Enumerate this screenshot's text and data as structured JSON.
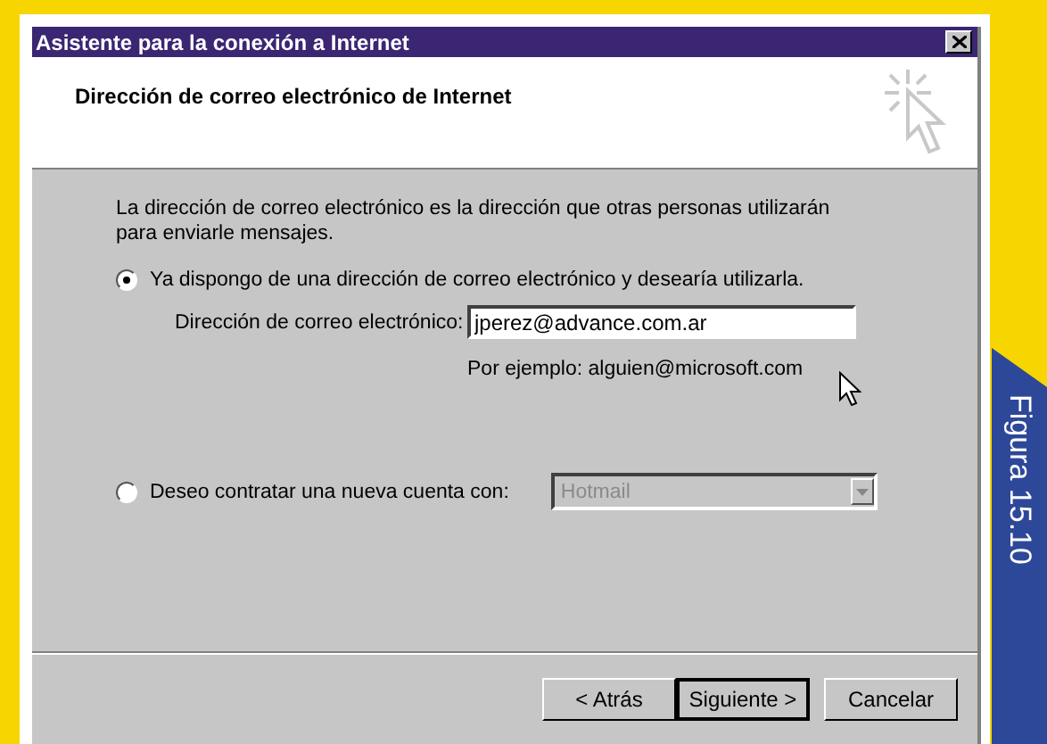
{
  "window": {
    "title": "Asistente para la conexión a Internet"
  },
  "header": {
    "title": "Dirección de correo electrónico de Internet"
  },
  "intro": "La dirección de correo electrónico es la dirección que otras personas utilizarán para enviarle mensajes.",
  "options": [
    {
      "label": "Ya dispongo de una dirección de correo electrónico y desearía utilizarla.",
      "selected": true
    },
    {
      "label": "Deseo contratar una nueva cuenta con:",
      "selected": false
    }
  ],
  "email_field": {
    "label": "Dirección de correo electrónico:",
    "value": "jperez@advance.com.ar"
  },
  "example": "Por ejemplo: alguien@microsoft.com",
  "provider_combo": {
    "value": "Hotmail",
    "disabled": true
  },
  "buttons": [
    {
      "label": "< Atrás",
      "default": false
    },
    {
      "label": "Siguiente >",
      "default": true
    },
    {
      "label": "Cancelar",
      "default": false
    }
  ],
  "figure_label": "Figura 15.10"
}
